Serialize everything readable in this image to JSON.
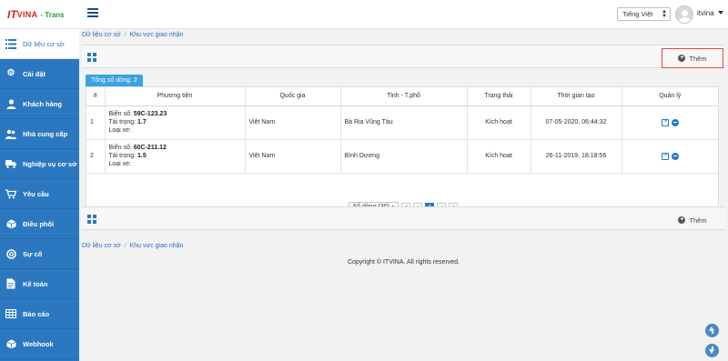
{
  "header": {
    "logo_it": "IT",
    "logo_vina": "VINA",
    "logo_suffix": "- Trans",
    "language": "Tiếng Việt",
    "username": "itvina"
  },
  "sidebar": {
    "items": [
      {
        "label": "Dữ liệu cơ sở",
        "icon": "list-icon",
        "active": true
      },
      {
        "label": "Cài đặt",
        "icon": "gear-icon"
      },
      {
        "label": "Khách hàng",
        "icon": "user-icon"
      },
      {
        "label": "Nhà cung cấp",
        "icon": "users-icon"
      },
      {
        "label": "Nghiệp vụ cơ sở",
        "icon": "truck-icon"
      },
      {
        "label": "Yêu cầu",
        "icon": "cart-icon"
      },
      {
        "label": "Điều phối",
        "icon": "cube-icon"
      },
      {
        "label": "Sự cố",
        "icon": "lifebuoy-icon"
      },
      {
        "label": "Kế toán",
        "icon": "file-icon"
      },
      {
        "label": "Báo cáo",
        "icon": "table-icon"
      },
      {
        "label": "Webhook",
        "icon": "box-icon"
      }
    ]
  },
  "breadcrumb": {
    "root": "Dữ liệu cơ sở",
    "sep": "/",
    "current": "Khu vực giao nhận"
  },
  "toolbar": {
    "add_label": "Thêm"
  },
  "table": {
    "count_label": "Tổng số dòng: 2",
    "columns": [
      "#",
      "Phương tiện",
      "Quốc gia",
      "Tỉnh - T.phố",
      "Trạng thái",
      "Thời gian tạo",
      "Quản lý"
    ],
    "vehicle_labels": {
      "plate": "Biển số:",
      "load": "Tải trọng:",
      "type": "Loại xe:"
    },
    "rows": [
      {
        "idx": "1",
        "plate": "59C-123.23",
        "load": "1.7",
        "country": "Việt Nam",
        "province": "Bà Rịa Vũng Tàu",
        "status": "Kích hoạt",
        "created": "07-05-2020, 06:44:32"
      },
      {
        "idx": "2",
        "plate": "60C-211.12",
        "load": "1.5",
        "country": "Việt Nam",
        "province": "Bình Dương",
        "status": "Kích hoạt",
        "created": "26-11-2019, 18:18:56"
      }
    ]
  },
  "pager": {
    "rows_label": "Số dòng (30)",
    "first": "«",
    "prev": "‹",
    "page": "1",
    "next": "›",
    "last": "»"
  },
  "footer": {
    "copyright": "Copyright © ITVINA. All rights reserved."
  },
  "colors": {
    "sidebar": "#2c78c0",
    "accent": "#3ca2e0",
    "highlight_border": "#d94a4a"
  }
}
